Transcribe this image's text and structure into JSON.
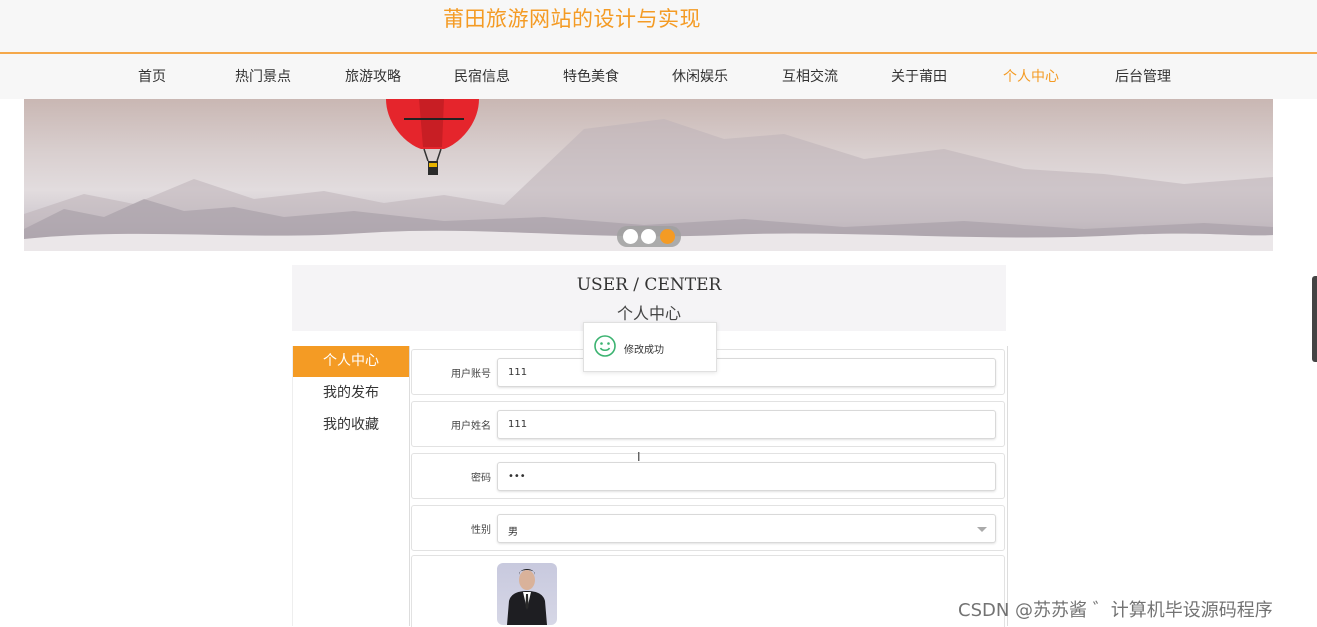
{
  "site": {
    "title": "莆田旅游网站的设计与实现"
  },
  "nav": {
    "items": [
      {
        "label": "首页"
      },
      {
        "label": "热门景点"
      },
      {
        "label": "旅游攻略"
      },
      {
        "label": "民宿信息"
      },
      {
        "label": "特色美食"
      },
      {
        "label": "休闲娱乐"
      },
      {
        "label": "互相交流"
      },
      {
        "label": "关于莆田"
      },
      {
        "label": "个人中心"
      },
      {
        "label": "后台管理"
      }
    ],
    "active": "个人中心"
  },
  "carousel": {
    "slide_count": 3,
    "active_index": 2
  },
  "user_center": {
    "title_en": "USER / CENTER",
    "title_cn": "个人中心"
  },
  "sidebar": {
    "items": [
      {
        "label": "个人中心"
      },
      {
        "label": "我的发布"
      },
      {
        "label": "我的收藏"
      }
    ]
  },
  "form": {
    "account": {
      "label": "用户账号",
      "value": "111"
    },
    "name": {
      "label": "用户姓名",
      "value": "111"
    },
    "password": {
      "label": "密码",
      "value": "•••"
    },
    "gender": {
      "label": "性别",
      "value": "男"
    }
  },
  "toast": {
    "message": "修改成功"
  },
  "watermark": {
    "text": "CSDN @苏苏酱  ゛计算机毕设源码程序"
  },
  "colors": {
    "accent": "#f49b24",
    "toast_icon": "#3cb371"
  }
}
